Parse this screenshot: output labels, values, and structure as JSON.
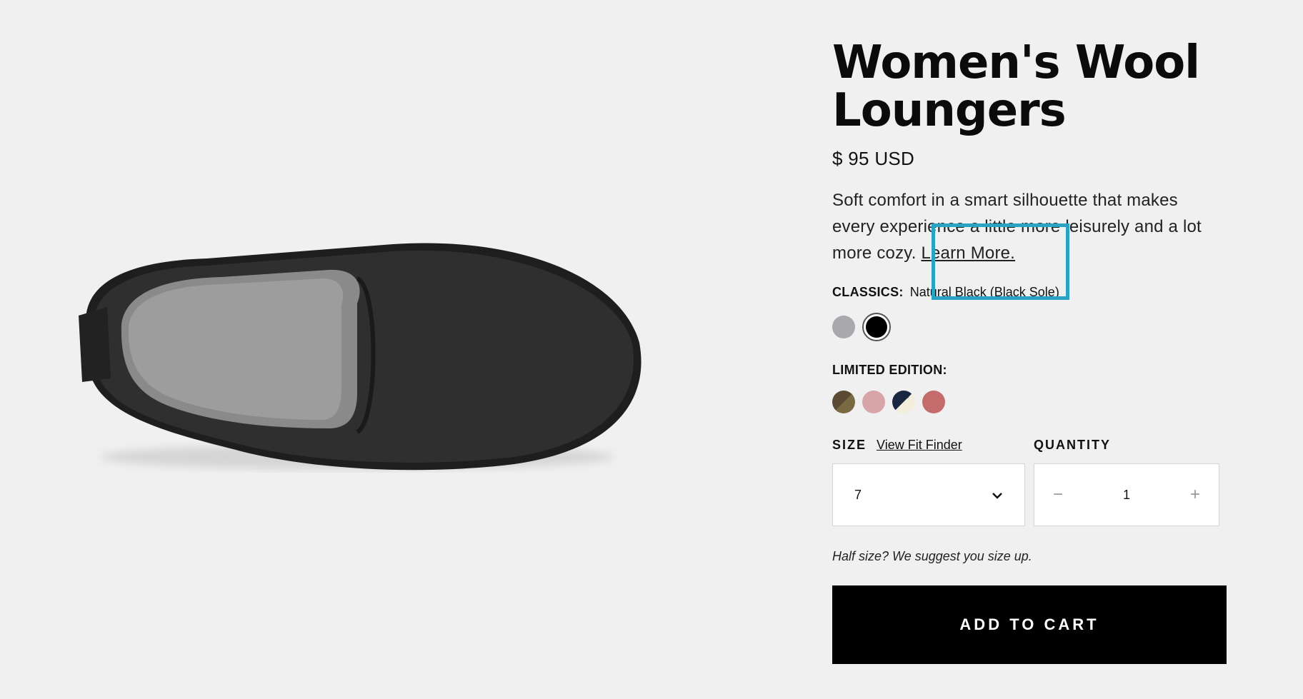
{
  "product": {
    "title": "Women's Wool Loungers",
    "price": "$ 95 USD",
    "description": "Soft comfort in a smart silhouette that makes every experience a little more leisurely and a lot more cozy. ",
    "learn_more": "Learn More."
  },
  "classics": {
    "label": "CLASSICS:",
    "selected_value": "Natural Black (Black Sole)",
    "swatches": [
      "#a9a8ad",
      "#000000"
    ]
  },
  "limited": {
    "label": "LIMITED EDITION:",
    "swatches": [
      "#5b4a33",
      "#d7a4a8",
      "#1a2740",
      "#c46b6b"
    ]
  },
  "size": {
    "label": "SIZE",
    "fit_finder": "View Fit Finder",
    "value": "7"
  },
  "quantity": {
    "label": "QUANTITY",
    "value": "1",
    "minus": "−",
    "plus": "+"
  },
  "note": "Half size? We suggest you size up.",
  "cart_label": "ADD TO CART",
  "colors": {
    "accent_highlight": "#2aa3c4",
    "button_bg": "#000000"
  }
}
